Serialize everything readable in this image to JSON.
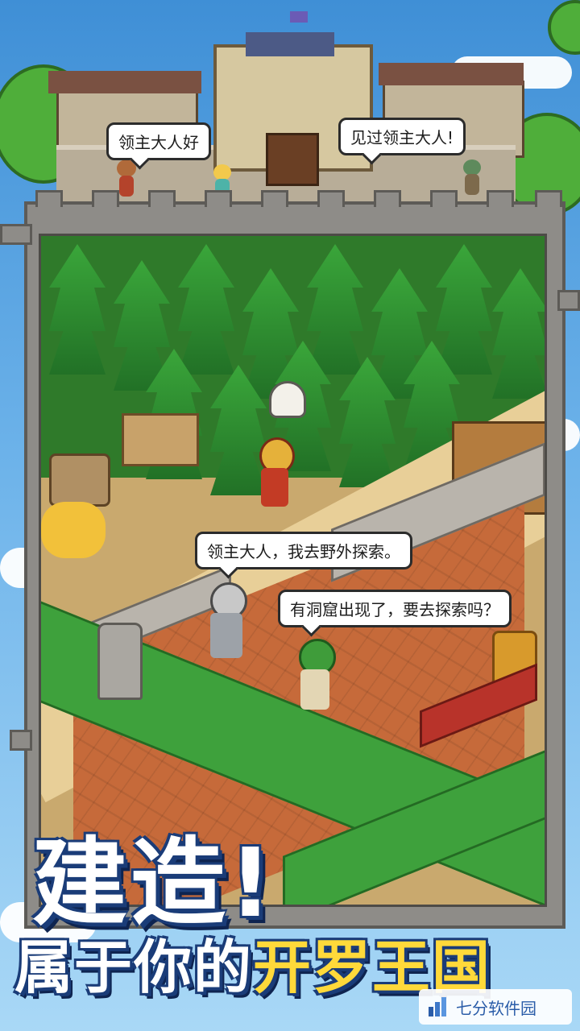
{
  "bubbles": {
    "villager_greeting_left": "领主大人好",
    "villager_greeting_right": "见过领主大人!",
    "knight_speech": "领主大人，我去野外探索。",
    "archer_speech": "有洞窟出现了，要去探索吗？"
  },
  "headline": {
    "line1": "建造!",
    "line2_white": "属于你的",
    "line2_yellow": "开罗王国"
  },
  "watermark": {
    "text": "七分软件园"
  },
  "colors": {
    "title_outline": "#1a3c78",
    "title_highlight": "#ffd93a",
    "sky": "#6db3ea"
  }
}
